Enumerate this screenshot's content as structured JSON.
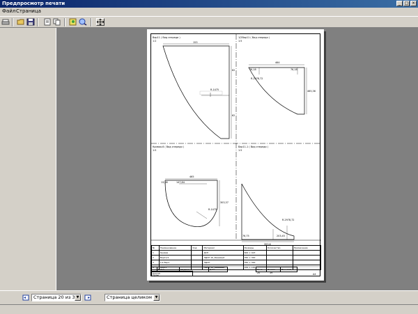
{
  "window": {
    "title": "Предпросмотр печати"
  },
  "menu": {
    "items": [
      "Файл",
      "Страница"
    ]
  },
  "toolbar": {
    "icons": [
      "print-icon",
      "open-icon",
      "save-icon",
      "page-setup-icon",
      "copy-icon",
      "zoom-in-icon",
      "zoom-out-icon",
      "move-icon"
    ]
  },
  "navigation": {
    "page_label": "Страница 20 из 39",
    "zoom_option": "Страница целиком"
  },
  "drawing": {
    "views": [
      {
        "title": "Вар11 ( Вид спереди )",
        "scale": "1:2"
      },
      {
        "title": "1/2Вар11 ( Вид спереди )",
        "scale": "1:5"
      },
      {
        "title": "Кривая-6 ( Вид спереди )",
        "scale": "1:5"
      },
      {
        "title": "Вар11-1 ( Вид спереди )",
        "scale": "1:5"
      }
    ],
    "dims": {
      "v1_top": "153",
      "v1_r1": "62",
      "v1_r2": "62",
      "v1_mid": "R-1475",
      "v2_top": "464",
      "v2_a": "76,18",
      "v2_b": "76,18",
      "v2_c": "R-2978,72",
      "v2_right": "465,36",
      "v3_top": "465",
      "v3_left": "13,08",
      "v3_mid": "147,84",
      "v3_right": "303,37",
      "v3_r": "R-1475",
      "v4_a": "76,75",
      "v4_b": "203,45",
      "v4_c": "R-2978,72",
      "v4_bot": "393,6"
    },
    "spec": {
      "headers": [
        "№",
        "Наименование",
        "Код",
        "Материал",
        "Размеры",
        "Количество",
        "Примечание"
      ],
      "rows": [
        [
          "1",
          "Кривая",
          "",
          "ДСП",
          "600 × 423",
          "",
          ""
        ],
        [
          "2",
          "Вар11/2",
          "",
          "ЛДСП 16_Бешевый",
          "350 × 300",
          "",
          ""
        ],
        [
          "3",
          "1/2 Вар1",
          "",
          "ЛДСП",
          "350 × 300",
          "",
          ""
        ],
        [
          "4",
          "Вар11",
          "",
          "ЛДСП 16_Бешевый",
          "164 × 100",
          "",
          ""
        ]
      ]
    },
    "stamp": {
      "cols": [
        "Ф.И.О.",
        "Подпись",
        "Дата"
      ],
      "sheet_labels": [
        "Лист",
        "Листов",
        "Масштаб"
      ],
      "sheet_values": [
        "20",
        "39",
        ""
      ],
      "rows": [
        "Разраб.",
        "Пров.",
        "Т.контр.",
        "Н.контр.",
        "Утв."
      ],
      "format": "А4"
    }
  }
}
